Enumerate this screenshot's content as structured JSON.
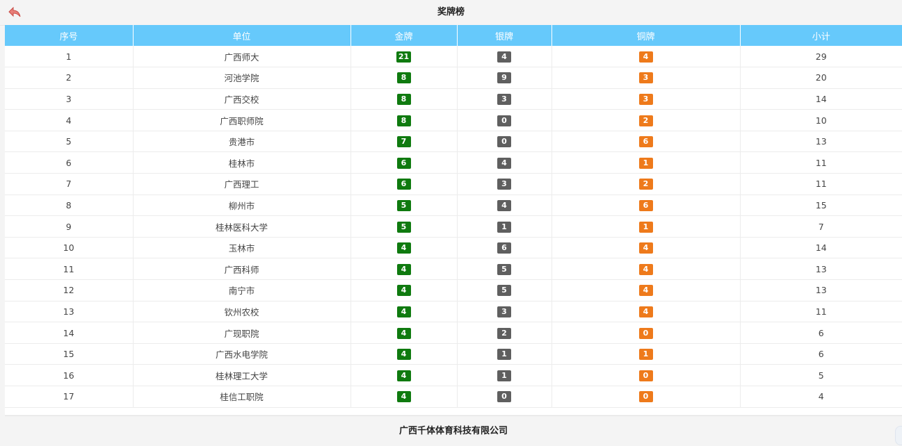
{
  "header": {
    "title": "奖牌榜"
  },
  "table": {
    "columns": [
      "序号",
      "单位",
      "金牌",
      "银牌",
      "铜牌",
      "小计"
    ],
    "rows": [
      {
        "rank": "1",
        "unit": "广西师大",
        "gold": "21",
        "silver": "4",
        "bronze": "4",
        "total": "29"
      },
      {
        "rank": "2",
        "unit": "河池学院",
        "gold": "8",
        "silver": "9",
        "bronze": "3",
        "total": "20"
      },
      {
        "rank": "3",
        "unit": "广西交校",
        "gold": "8",
        "silver": "3",
        "bronze": "3",
        "total": "14"
      },
      {
        "rank": "4",
        "unit": "广西职师院",
        "gold": "8",
        "silver": "0",
        "bronze": "2",
        "total": "10"
      },
      {
        "rank": "5",
        "unit": "贵港市",
        "gold": "7",
        "silver": "0",
        "bronze": "6",
        "total": "13"
      },
      {
        "rank": "6",
        "unit": "桂林市",
        "gold": "6",
        "silver": "4",
        "bronze": "1",
        "total": "11"
      },
      {
        "rank": "7",
        "unit": "广西理工",
        "gold": "6",
        "silver": "3",
        "bronze": "2",
        "total": "11"
      },
      {
        "rank": "8",
        "unit": "柳州市",
        "gold": "5",
        "silver": "4",
        "bronze": "6",
        "total": "15"
      },
      {
        "rank": "9",
        "unit": "桂林医科大学",
        "gold": "5",
        "silver": "1",
        "bronze": "1",
        "total": "7"
      },
      {
        "rank": "10",
        "unit": "玉林市",
        "gold": "4",
        "silver": "6",
        "bronze": "4",
        "total": "14"
      },
      {
        "rank": "11",
        "unit": "广西科师",
        "gold": "4",
        "silver": "5",
        "bronze": "4",
        "total": "13"
      },
      {
        "rank": "12",
        "unit": "南宁市",
        "gold": "4",
        "silver": "5",
        "bronze": "4",
        "total": "13"
      },
      {
        "rank": "13",
        "unit": "钦州农校",
        "gold": "4",
        "silver": "3",
        "bronze": "4",
        "total": "11"
      },
      {
        "rank": "14",
        "unit": "广现职院",
        "gold": "4",
        "silver": "2",
        "bronze": "0",
        "total": "6"
      },
      {
        "rank": "15",
        "unit": "广西水电学院",
        "gold": "4",
        "silver": "1",
        "bronze": "1",
        "total": "6"
      },
      {
        "rank": "16",
        "unit": "桂林理工大学",
        "gold": "4",
        "silver": "1",
        "bronze": "0",
        "total": "5"
      },
      {
        "rank": "17",
        "unit": "桂信工职院",
        "gold": "4",
        "silver": "0",
        "bronze": "0",
        "total": "4"
      }
    ]
  },
  "footer": {
    "company": "广西千体体育科技有限公司"
  },
  "colors": {
    "header_bg": "#66c9fb",
    "gold": "#0f7a0f",
    "silver": "#5f5f5f",
    "bronze": "#ee7a1b"
  },
  "icons": {
    "back": "back-arrow-icon"
  }
}
